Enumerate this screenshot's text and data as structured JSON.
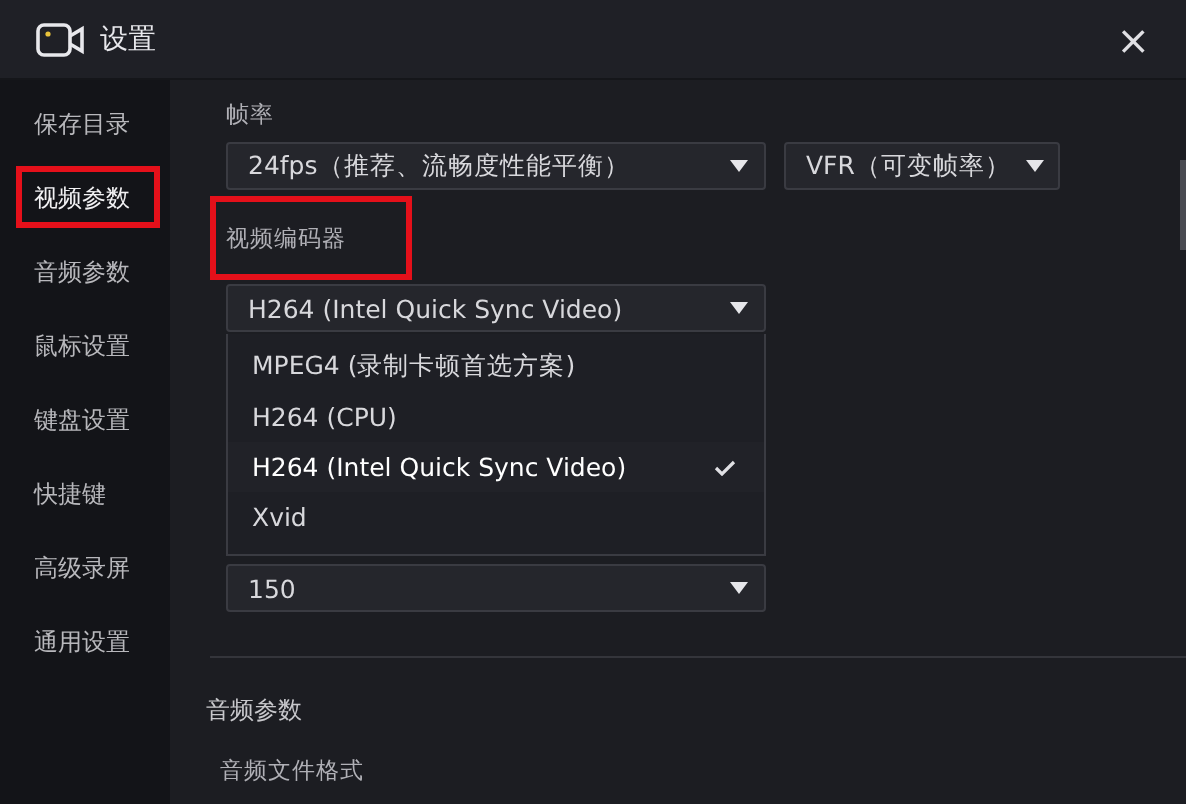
{
  "window": {
    "title": "设置",
    "close": "×"
  },
  "sidebar": {
    "items": [
      {
        "label": "保存目录",
        "selected": false,
        "highlighted": false
      },
      {
        "label": "视频参数",
        "selected": true,
        "highlighted": true
      },
      {
        "label": "音频参数",
        "selected": false,
        "highlighted": false
      },
      {
        "label": "鼠标设置",
        "selected": false,
        "highlighted": false
      },
      {
        "label": "键盘设置",
        "selected": false,
        "highlighted": false
      },
      {
        "label": "快捷键",
        "selected": false,
        "highlighted": false
      },
      {
        "label": "高级录屏",
        "selected": false,
        "highlighted": false
      },
      {
        "label": "通用设置",
        "selected": false,
        "highlighted": false
      }
    ]
  },
  "video": {
    "frame_rate": {
      "label": "帧率",
      "fps": {
        "value": "24fps（推荐、流畅度性能平衡）"
      },
      "mode": {
        "value": "VFR（可变帧率）"
      }
    },
    "encoder": {
      "label": "视频编码器",
      "highlighted": true,
      "value": "H264 (Intel Quick Sync Video)",
      "expanded": true,
      "options": [
        {
          "label": "MPEG4 (录制卡顿首选方案)",
          "selected": false
        },
        {
          "label": "H264 (CPU)",
          "selected": false
        },
        {
          "label": "H264 (Intel Quick Sync Video)",
          "selected": true
        },
        {
          "label": "Xvid",
          "selected": false
        }
      ]
    },
    "bitrate": {
      "value": "150"
    }
  },
  "audio": {
    "heading": "音频参数",
    "format_label": "音频文件格式"
  }
}
